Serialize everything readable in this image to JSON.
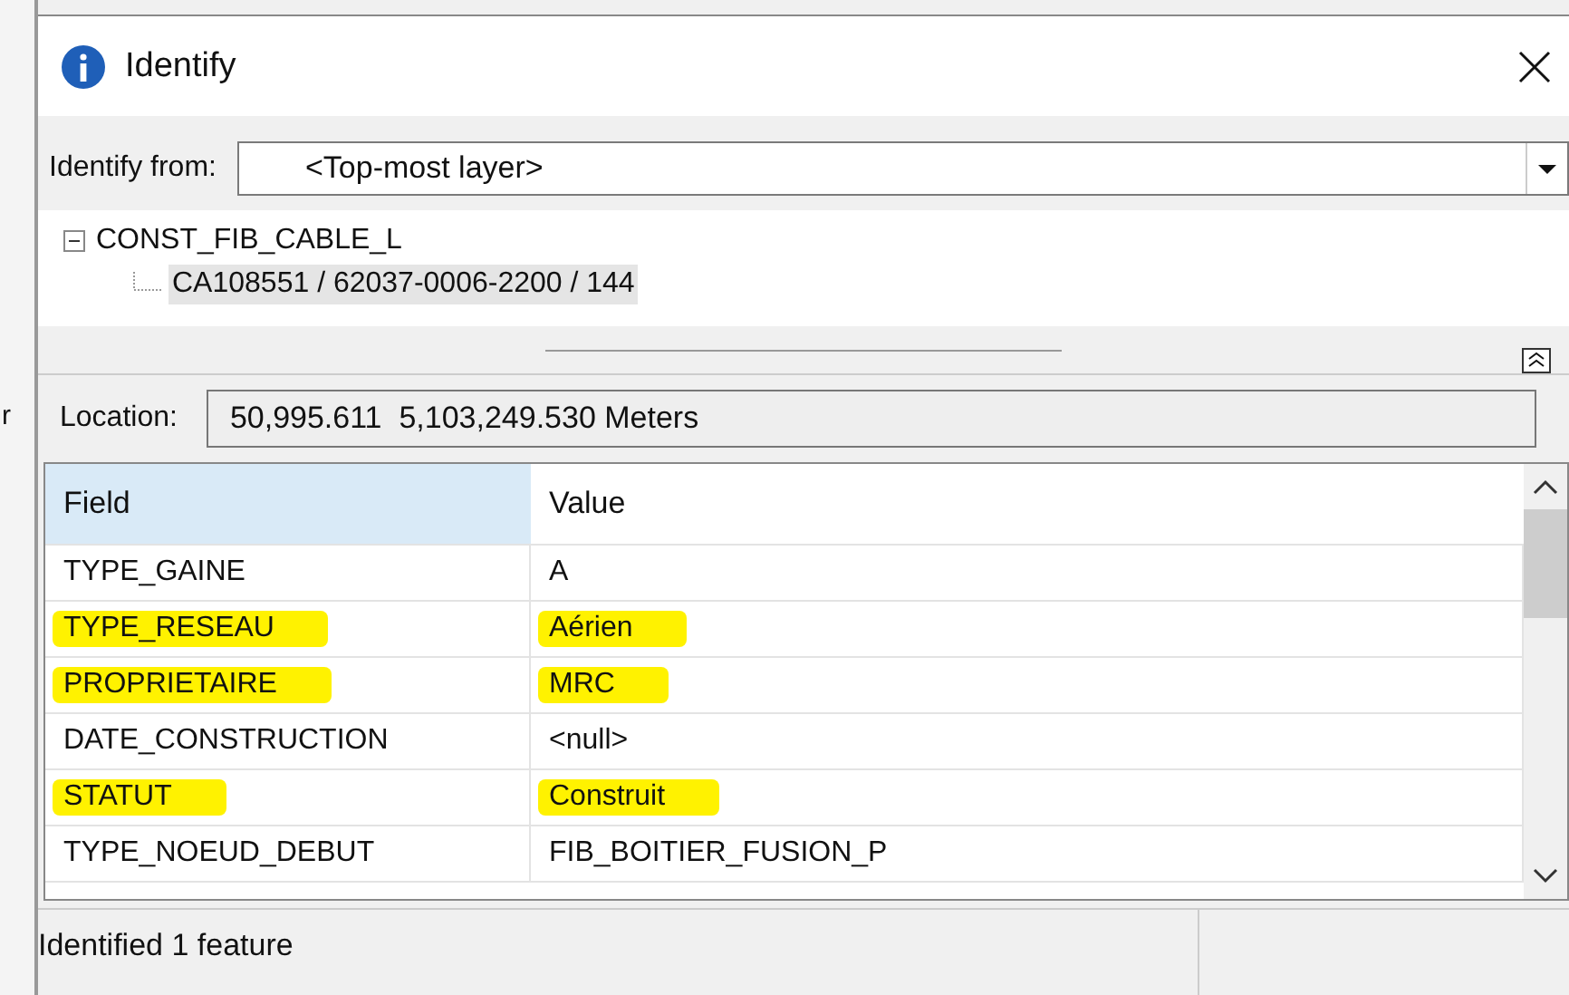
{
  "background_fragment": "r",
  "window": {
    "title": "Identify"
  },
  "identify_from": {
    "label": "Identify from:",
    "value": "<Top-most layer>"
  },
  "tree": [
    {
      "label": "CONST_FIB_CABLE_L",
      "expanded": true,
      "children": [
        {
          "label": "CA108551 / 62037-0006-2200 / 144",
          "selected": true
        }
      ]
    }
  ],
  "location": {
    "label": "Location:",
    "value": "50,995.611  5,103,249.530 Meters"
  },
  "table": {
    "columns": [
      "Field",
      "Value"
    ],
    "rows": [
      {
        "field": "TYPE_GAINE",
        "value": "A",
        "highlighted": false
      },
      {
        "field": "TYPE_RESEAU",
        "value": "Aérien",
        "highlighted": true
      },
      {
        "field": "PROPRIETAIRE",
        "value": "MRC",
        "highlighted": true
      },
      {
        "field": "DATE_CONSTRUCTION",
        "value": "<null>",
        "highlighted": false
      },
      {
        "field": "STATUT",
        "value": "Construit",
        "highlighted": true
      },
      {
        "field": "TYPE_NOEUD_DEBUT",
        "value": "FIB_BOITIER_FUSION_P",
        "highlighted": false
      }
    ]
  },
  "status_bar": "Identified 1 feature"
}
